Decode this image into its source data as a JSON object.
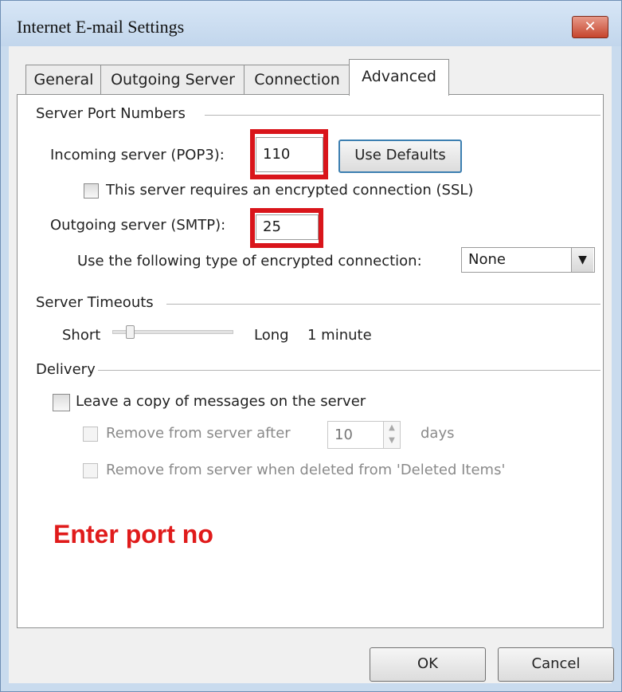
{
  "window": {
    "title": "Internet E-mail Settings",
    "close_glyph": "✕"
  },
  "tabs": [
    {
      "label": "General"
    },
    {
      "label": "Outgoing Server"
    },
    {
      "label": "Connection"
    },
    {
      "label": "Advanced"
    }
  ],
  "active_tab": "Advanced",
  "ports": {
    "group_label": "Server Port Numbers",
    "incoming_label": "Incoming server (POP3):",
    "incoming_value": "110",
    "use_defaults_label": "Use Defaults",
    "ssl_label": "This server requires an encrypted connection (SSL)",
    "ssl_checked": false,
    "outgoing_label": "Outgoing server (SMTP):",
    "outgoing_value": "25",
    "encryption_label": "Use the following type of encrypted connection:",
    "encryption_value": "None"
  },
  "timeouts": {
    "group_label": "Server Timeouts",
    "short_label": "Short",
    "long_label": "Long",
    "value_label": "1 minute",
    "slider_fraction": 0.12
  },
  "delivery": {
    "group_label": "Delivery",
    "leave_copy_label": "Leave a copy of messages on the server",
    "leave_copy_checked": false,
    "remove_after_label": "Remove from server after",
    "remove_after_value": "10",
    "days_label": "days",
    "remove_deleted_label": "Remove from server when deleted from 'Deleted Items'"
  },
  "annotation": {
    "text": "Enter port no",
    "color": "#e01b1b"
  },
  "footer": {
    "ok_label": "OK",
    "cancel_label": "Cancel"
  },
  "icons": {
    "combo": "chevron-down-icon",
    "spin_up": "▲",
    "spin_down": "▼"
  },
  "colors": {
    "highlight_box": "#d9151b",
    "use_defaults_border": "#3c7fb1"
  }
}
